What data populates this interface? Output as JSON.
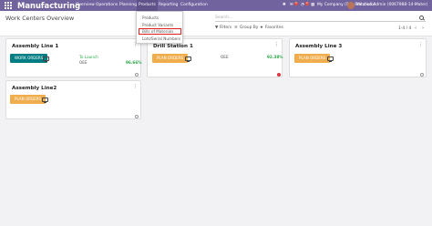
{
  "app": {
    "title": "Manufacturing"
  },
  "topnav": {
    "items": [
      "Overview",
      "Operations",
      "Planning",
      "Products",
      "Reporting",
      "Configuration"
    ]
  },
  "systray": {
    "chat_count": "5",
    "activity_count": "2",
    "company": "My Company (San Francisco)",
    "user": "Mitchell Admin (0067988-14-Mater)"
  },
  "products_menu": {
    "items": [
      "Products",
      "Product Variants",
      "Bills of Materials",
      "Lots/Serial Numbers"
    ]
  },
  "control": {
    "breadcrumb": "Work Centers Overview",
    "search_placeholder": "Search...",
    "filters": "Filters",
    "group_by": "Group By",
    "favorites": "Favorites",
    "pager": "1-4 / 4"
  },
  "cards": [
    {
      "title": "Assembly Line 1",
      "button": "Work Orders",
      "stat_label": "To Launch",
      "stat_value": "OEE",
      "stat_pct": "96.66%"
    },
    {
      "title": "Drill Station 1",
      "button": "Plan Orders",
      "stat_value": "OEE",
      "stat_pct": "92.38%"
    },
    {
      "title": "Assembly Line 3",
      "button": "Plan Orders"
    },
    {
      "title": "Assembly Line2",
      "button": "Plan Orders"
    }
  ],
  "colors": {
    "brand": "#71639e",
    "primary": "#017e84",
    "warning": "#f0ad4e",
    "alert": "#dc3545",
    "ok": "#28a745"
  }
}
